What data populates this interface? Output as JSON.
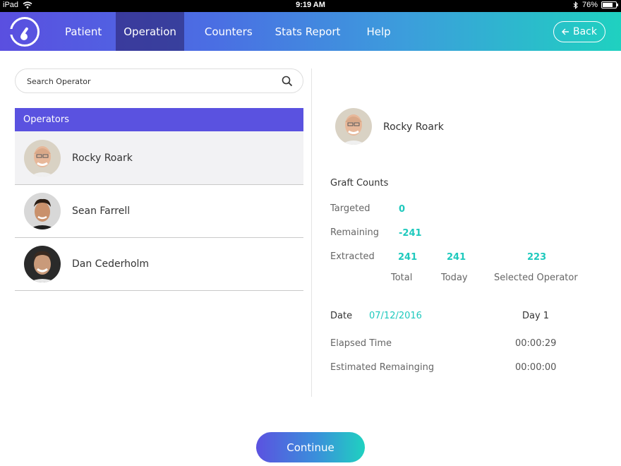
{
  "status_bar": {
    "device": "iPad",
    "time": "9:19 AM",
    "battery": "76%",
    "battery_level": 0.76
  },
  "nav": {
    "tabs": [
      {
        "label": "Patient",
        "active": false
      },
      {
        "label": "Operation",
        "active": true
      },
      {
        "label": "Counters",
        "active": false
      },
      {
        "label": "Stats Report",
        "active": false
      },
      {
        "label": "Help",
        "active": false
      }
    ],
    "back_label": "Back"
  },
  "search": {
    "placeholder": "Search Operator"
  },
  "operators": {
    "header": "Operators",
    "items": [
      {
        "name": "Rocky Roark",
        "selected": true
      },
      {
        "name": "Sean Farrell",
        "selected": false
      },
      {
        "name": "Dan Cederholm",
        "selected": false
      }
    ]
  },
  "detail": {
    "operator_name": "Rocky Roark",
    "graft_counts_title": "Graft Counts",
    "targeted_label": "Targeted",
    "targeted_value": "0",
    "remaining_label": "Remaining",
    "remaining_value": "-241",
    "extracted_label": "Extracted",
    "extracted_total": "241",
    "extracted_today": "241",
    "extracted_selected": "223",
    "total_label": "Total",
    "today_label": "Today",
    "selected_operator_label": "Selected Operator",
    "date_label": "Date",
    "date_value": "07/12/2016",
    "day_label": "Day 1",
    "elapsed_label": "Elapsed Time",
    "elapsed_value": "00:00:29",
    "estimated_label": "Estimated Remainging",
    "estimated_value": "00:00:00"
  },
  "continue_label": "Continue",
  "colors": {
    "accent_purple": "#5a52e0",
    "accent_teal": "#1ec9bd"
  }
}
